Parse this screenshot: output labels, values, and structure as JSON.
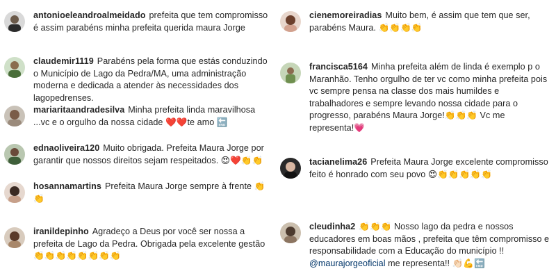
{
  "left": [
    {
      "user": "antonioeleandroalmeidado",
      "text": "prefeita que tem compromisso é assim parabéns minha prefeita querida maura Jorge",
      "emoji": ""
    },
    {
      "user": "claudemir1119",
      "text": "Parabéns pela forma que estás conduzindo o Município de Lago da Pedra/MA, uma administração moderna e dedicada a atender às necessidades dos lagopedrenses.",
      "emoji": ""
    },
    {
      "user": "mariaritaandradesilva",
      "text": "Minha prefeita linda maravilhosa ...vc e o orgulho da nossa cidade ❤️❤️te amo 🔚",
      "emoji": ""
    },
    {
      "user": "ednaoliveira120",
      "text": "Muito obrigada. Prefeita Maura Jorge por garantir que nossos direitos sejam respeitados. 😍❤️👏👏",
      "emoji": ""
    },
    {
      "user": "hosannamartins",
      "text": "Prefeita Maura Jorge sempre à frente 👏👏",
      "emoji": ""
    },
    {
      "user": "iranildepinho",
      "text": "Agradeço a Deus por você ser nossa a prefeita de Lago da Pedra. Obrigada pela excelente gestão 👏👏👏👏👏👏👏👏",
      "emoji": ""
    }
  ],
  "right": [
    {
      "user": "cienemoreiradias",
      "text": "Muito bem, é assim que tem que ser, parabéns Maura. 👏👏👏👏",
      "emoji": ""
    },
    {
      "user": "francisca5164",
      "text": "Minha prefeita além de linda é exemplo p o Maranhão. Tenho orgulho de ter vc como minha prefeita pois vc sempre pensa na classe dos mais humildes e trabalhadores e sempre levando nossa cidade para o progresso, parabéns Maura Jorge!👏👏👏 Vc me representa!💗",
      "emoji": ""
    },
    {
      "user": "tacianelima26",
      "text": "Prefeita Maura Jorge excelente compromisso feito é honrado com seu povo 😍👏👏👏👏👏",
      "emoji": ""
    },
    {
      "user": "cleudinha2",
      "text": "👏👏👏 Nosso lago da pedra e nossos educadores em boas mãos , prefeita que têm compromisso e responsabilidade com a Educação do município !!",
      "mention": "@maurajorgeoficial",
      "tail": " me representa!! 👏🏻💪🔚"
    }
  ],
  "colors": {
    "text": "#262626",
    "mention": "#003569",
    "background": "#ffffff"
  }
}
